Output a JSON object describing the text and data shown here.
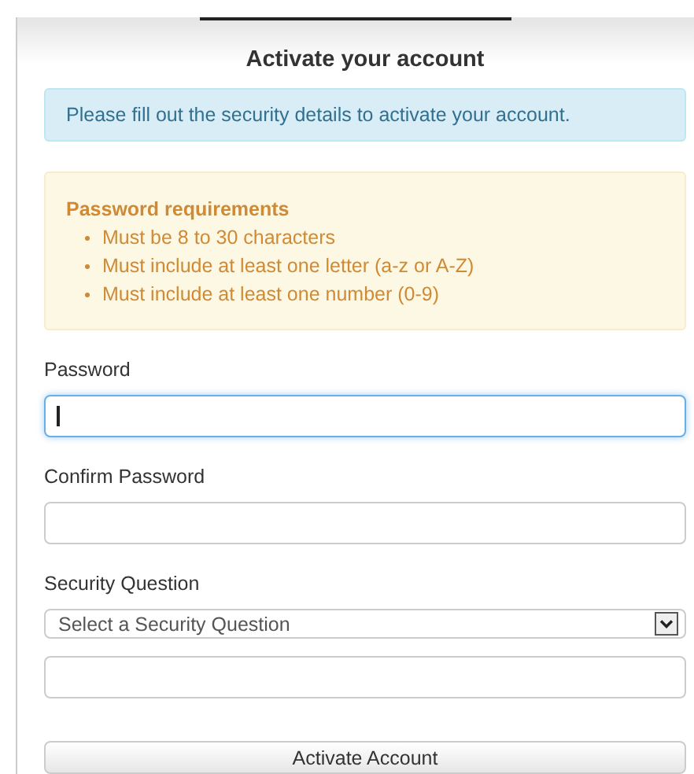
{
  "title": "Activate your account",
  "info": "Please fill out the security details to activate your account.",
  "requirements": {
    "heading": "Password requirements",
    "items": [
      "Must be 8 to 30 characters",
      "Must include at least one letter (a-z or A-Z)",
      "Must include at least one number (0-9)"
    ]
  },
  "fields": [
    {
      "kind": "text",
      "label": "Password",
      "focused": true
    },
    {
      "kind": "text",
      "label": "Confirm Password",
      "focused": false
    },
    {
      "kind": "select",
      "label": "Security Question",
      "value": "Select a Security Question",
      "focused": false
    },
    {
      "kind": "text",
      "focused": false
    }
  ],
  "button": "Activate Account"
}
